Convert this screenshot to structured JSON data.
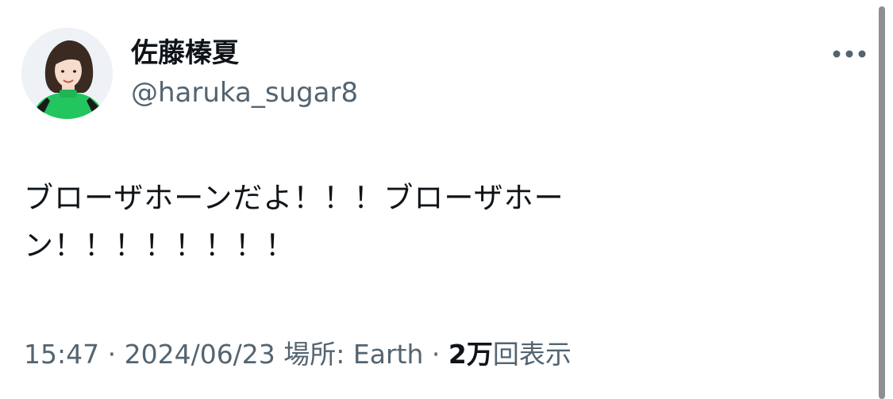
{
  "tweet": {
    "author": {
      "display_name": "佐藤榛夏",
      "handle": "@haruka_sugar8",
      "avatar": "profile-photo"
    },
    "more_icon": "more-horizontal-icon",
    "text": "ブローザホーンだよ！！！ブローザホーン！！！！！！！！",
    "meta": {
      "time": "15:47",
      "separator1": " · ",
      "date": "2024/06/23",
      "location_label": "場所: Earth",
      "separator2": " · ",
      "view_count": "2万",
      "view_label": "回表示"
    }
  },
  "colors": {
    "text_primary": "#0f1419",
    "text_secondary": "#536471",
    "avatar_shirt": "#22c55e",
    "scrollbar": "#8e8e93"
  }
}
